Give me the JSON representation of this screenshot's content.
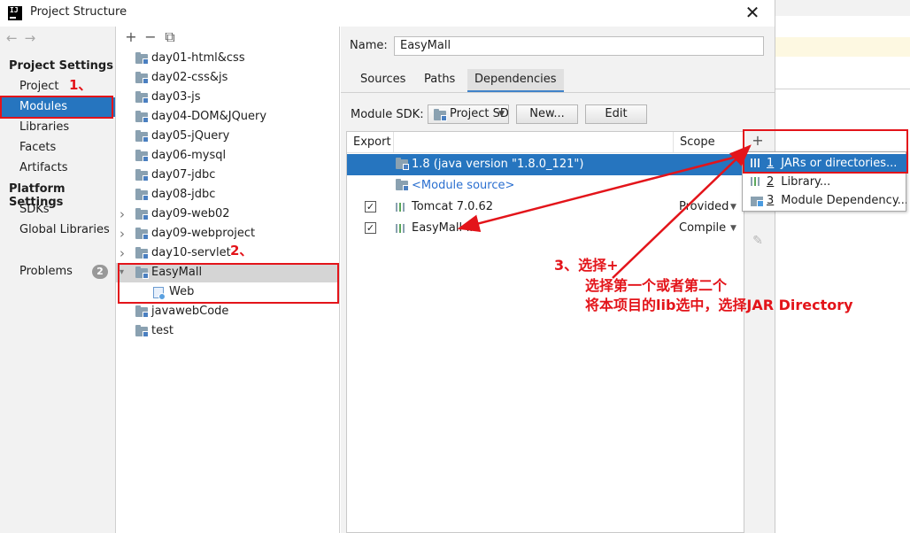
{
  "window": {
    "title": "Project Structure",
    "close_symbol": "✕"
  },
  "sidebar": {
    "project_settings_label": "Project Settings",
    "project_items": [
      "Project",
      "Modules",
      "Libraries",
      "Facets",
      "Artifacts"
    ],
    "selected": "Modules",
    "platform_settings_label": "Platform Settings",
    "platform_items": [
      "SDKs",
      "Global Libraries"
    ],
    "problems_label": "Problems",
    "problems_count": "2"
  },
  "modules": {
    "toolbar": [
      "+",
      "−",
      "⧉"
    ],
    "items": [
      {
        "label": "day01-html&css",
        "expandable": false
      },
      {
        "label": "day02-css&js",
        "expandable": false
      },
      {
        "label": "day03-js",
        "expandable": false
      },
      {
        "label": "day04-DOM&JQuery",
        "expandable": false
      },
      {
        "label": "day05-jQuery",
        "expandable": false
      },
      {
        "label": "day06-mysql",
        "expandable": false
      },
      {
        "label": "day07-jdbc",
        "expandable": false
      },
      {
        "label": "day08-jdbc",
        "expandable": false
      },
      {
        "label": "day09-web02",
        "expandable": true
      },
      {
        "label": "day09-webproject",
        "expandable": true
      },
      {
        "label": "day10-servlet",
        "expandable": true
      },
      {
        "label": "EasyMall",
        "expandable": true,
        "expanded": true,
        "selected": true
      },
      {
        "label": "Web",
        "child": true
      },
      {
        "label": "javawebCode",
        "expandable": false
      },
      {
        "label": "test",
        "expandable": false
      }
    ]
  },
  "detail": {
    "name_label": "Name:",
    "name_value": "EasyMall",
    "tabs": [
      "Sources",
      "Paths",
      "Dependencies"
    ],
    "active_tab": "Dependencies",
    "module_sdk_label": "Module SDK:",
    "module_sdk_value": "Project SDK",
    "new_button": "New...",
    "edit_button": "Edit",
    "table": {
      "headers": {
        "export": "Export",
        "scope": "Scope"
      },
      "rows": [
        {
          "name": "1.8 (java version \"1.8.0_121\")",
          "type": "sdk",
          "checkbox": false,
          "scope": ""
        },
        {
          "name": "<Module source>",
          "type": "module-source",
          "checkbox": false,
          "scope": ""
        },
        {
          "name": "Tomcat 7.0.62",
          "type": "library",
          "checkbox": true,
          "scope": "Provided"
        },
        {
          "name": "EasyMall-lib",
          "type": "library",
          "checkbox": true,
          "scope": "Compile"
        }
      ]
    },
    "toolbar": {
      "add": "+",
      "edit": "✎"
    }
  },
  "popup": {
    "items": [
      {
        "num": "1",
        "label": "JARs or directories...",
        "icon": "jar-icon"
      },
      {
        "num": "2",
        "label": "Library...",
        "icon": "library-icon"
      },
      {
        "num": "3",
        "label": "Module Dependency...",
        "icon": "module-icon"
      }
    ]
  },
  "annotations": {
    "step1": "1、",
    "step2": "2、",
    "step3_line1": "3、选择+",
    "step3_line2": "选择第一个或者第二个",
    "step3_line3": "将本项目的lib选中，选择JAR Directory"
  },
  "colors": {
    "selection_blue": "#2675bf",
    "annotation_red": "#e3141a",
    "link_blue": "#2a6fd0"
  }
}
